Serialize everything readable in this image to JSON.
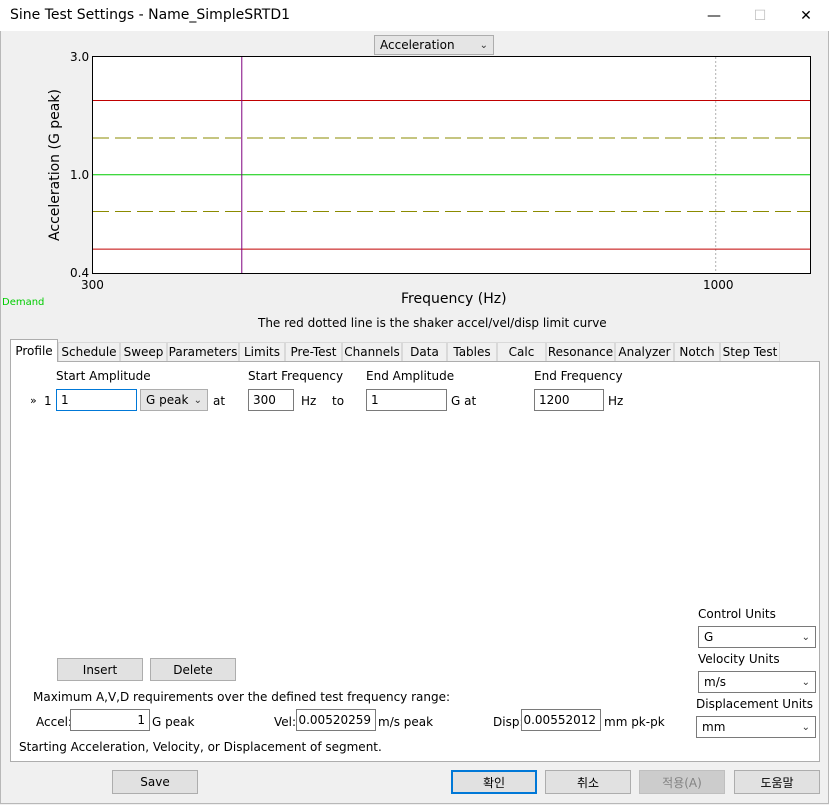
{
  "window": {
    "title": "Sine Test Settings - Name_SimpleSRTD1",
    "minimize": "—",
    "maximize": "☐",
    "close": "✕"
  },
  "chart_selector": {
    "value": "Acceleration"
  },
  "chart_data": {
    "type": "line",
    "xlabel": "Frequency (Hz)",
    "ylabel": "Acceleration (G peak)",
    "x_scale": "log",
    "y_scale": "log",
    "xlim": [
      300,
      1200
    ],
    "ylim": [
      0.4,
      3.0
    ],
    "x_ticks": [
      "300",
      "1000"
    ],
    "y_ticks": [
      "3.0",
      "1.0",
      "0.4"
    ],
    "series": [
      {
        "color": "#00cc00",
        "x": [
          300,
          1200
        ],
        "y": [
          1.0,
          1.0
        ]
      },
      {
        "color": "#8b8b00",
        "dashed": true,
        "x": [
          300,
          1200
        ],
        "y": [
          1.41,
          1.41
        ]
      },
      {
        "color": "#8b8b00",
        "dashed": true,
        "x": [
          300,
          1200
        ],
        "y": [
          0.71,
          0.71
        ]
      },
      {
        "color": "#c00000",
        "x": [
          300,
          1200
        ],
        "y": [
          2.0,
          2.0
        ]
      },
      {
        "color": "#c00000",
        "x": [
          300,
          1200
        ],
        "y": [
          0.5,
          0.5
        ]
      }
    ],
    "markers": [
      {
        "color": "#800080",
        "x": 400
      }
    ],
    "grid_x": [
      1000
    ]
  },
  "demand_label": "Demand",
  "chart_note": "The red dotted line is the shaker accel/vel/disp limit curve",
  "tabs": [
    "Profile",
    "Schedule",
    "Sweep",
    "Parameters",
    "Limits",
    "Pre-Test",
    "Channels",
    "Data",
    "Tables",
    "Calc",
    "Resonance",
    "Analyzer",
    "Notch",
    "Step Test"
  ],
  "profile": {
    "headers": {
      "start_amp": "Start Amplitude",
      "start_freq": "Start Frequency",
      "end_amp": "End Amplitude",
      "end_freq": "End Frequency"
    },
    "row": {
      "marker": "»",
      "index": "1",
      "start_amp": "1",
      "unit": "G peak",
      "at1": "at",
      "start_freq": "300",
      "hz1": "Hz",
      "to": "to",
      "end_amp": "1",
      "g_at": "G at",
      "end_freq": "1200",
      "hz2": "Hz"
    },
    "insert": "Insert",
    "delete": "Delete",
    "max_note": "Maximum A,V,D requirements over the defined test frequency range:",
    "accel_label": "Accel:",
    "accel_value": "1",
    "accel_unit": "G peak",
    "vel_label": "Vel:",
    "vel_value": "0.00520259",
    "vel_unit": "m/s peak",
    "disp_label": "Disp:",
    "disp_value": "0.00552012",
    "disp_unit": "mm pk-pk",
    "status": "Starting Acceleration, Velocity, or Displacement of segment."
  },
  "units": {
    "control_label": "Control Units",
    "control_value": "G",
    "velocity_label": "Velocity Units",
    "velocity_value": "m/s",
    "displacement_label": "Displacement Units",
    "displacement_value": "mm"
  },
  "buttons": {
    "save": "Save",
    "ok": "확인",
    "cancel": "취소",
    "apply": "적용(A)",
    "help": "도움말"
  }
}
